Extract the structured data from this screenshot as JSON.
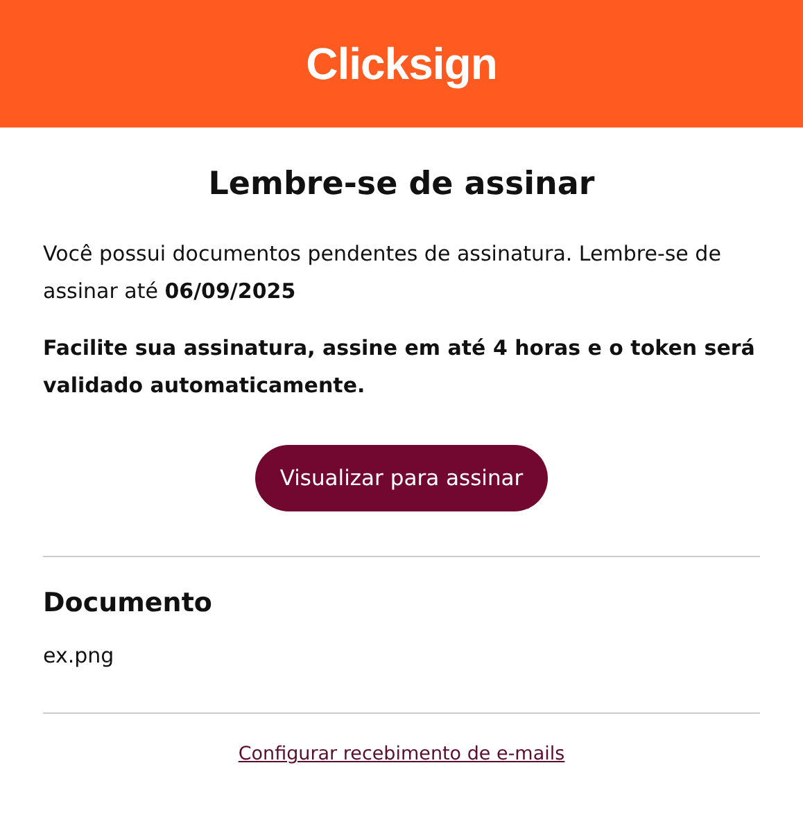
{
  "header": {
    "logo": "Clicksign"
  },
  "title": "Lembre-se de assinar",
  "message": "Você possui documentos pendentes de assinatura. Lembre-se de assinar até **06/09/2025**",
  "notice": "Facilite sua assinatura, assine em até 4 horas e o token será validado automaticamente.",
  "button": "Visualizar para assinar",
  "document": {
    "heading": "Documento",
    "name": "ex.png"
  },
  "footer_link": "Configurar recebimento de e-mails"
}
